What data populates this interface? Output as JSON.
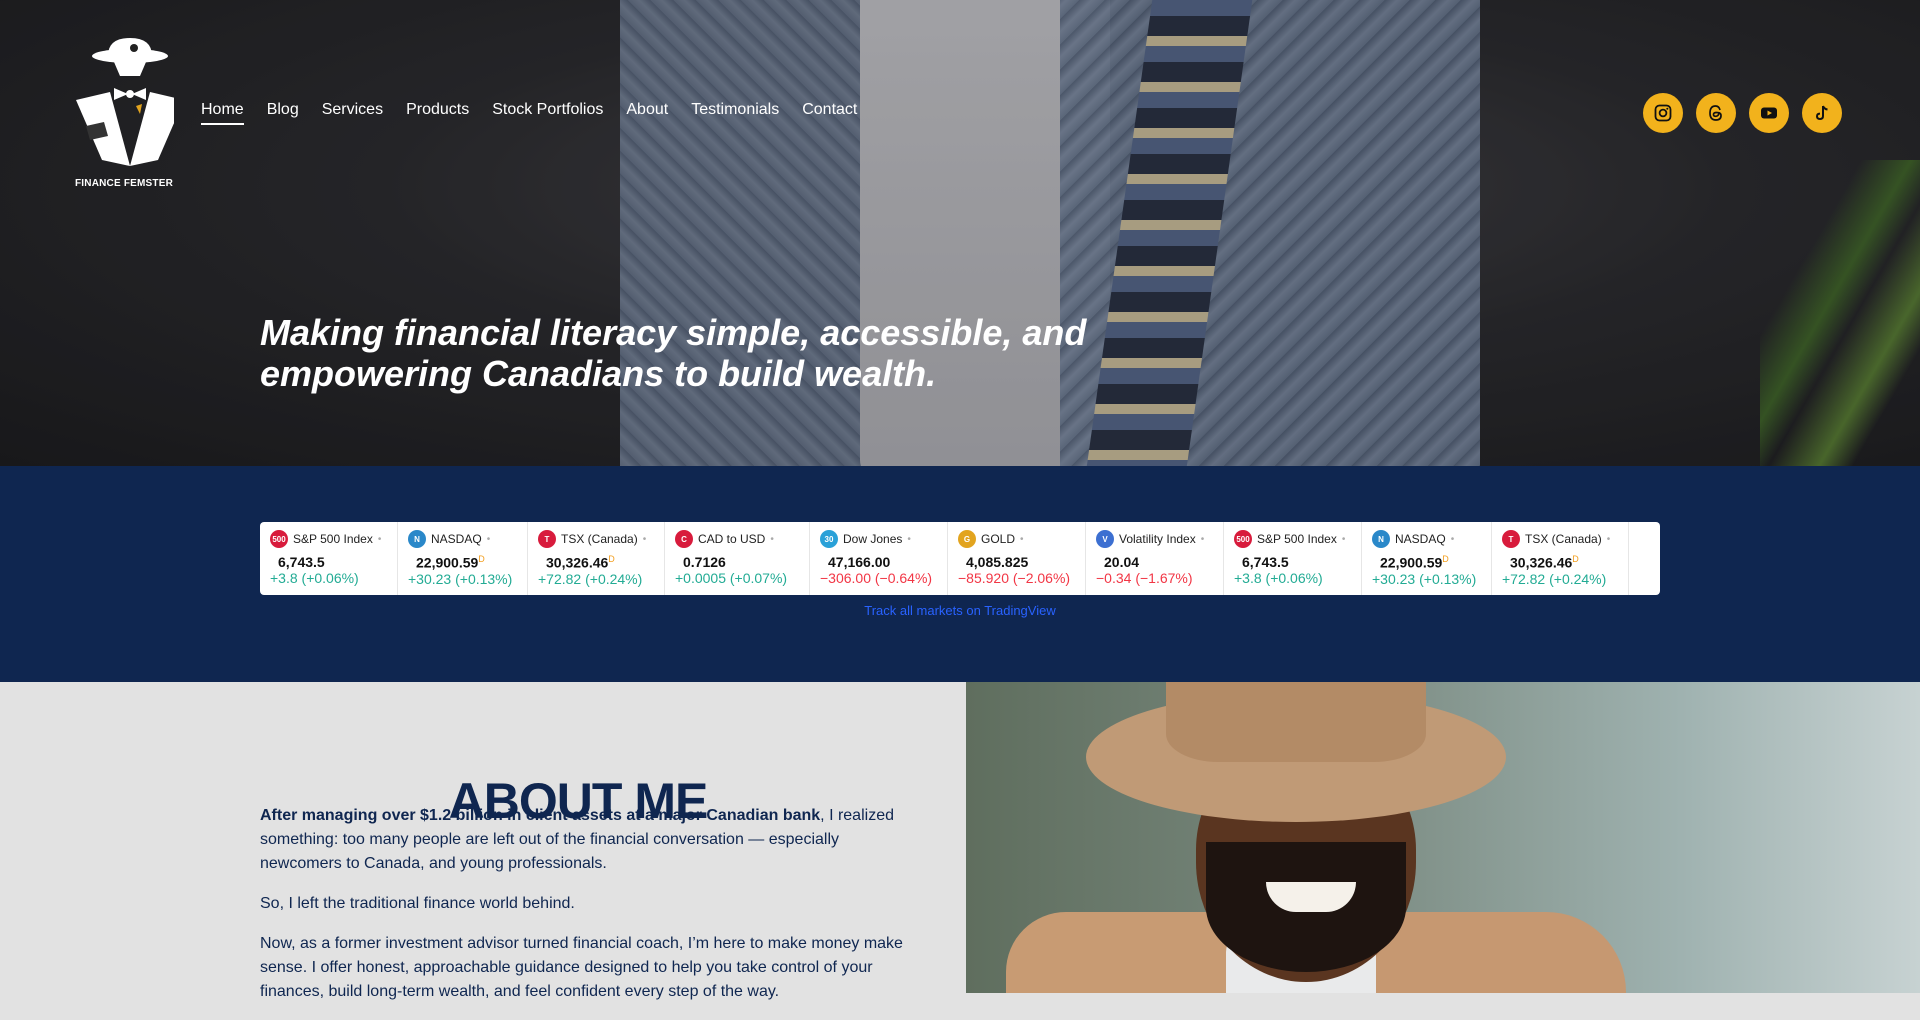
{
  "brand": {
    "name": "FINANCE FEMSTER"
  },
  "nav": {
    "items": [
      "Home",
      "Blog",
      "Services",
      "Products",
      "Stock Portfolios",
      "About",
      "Testimonials",
      "Contact"
    ],
    "active": "Home"
  },
  "socials": [
    "instagram-icon",
    "threads-icon",
    "youtube-icon",
    "tiktok-icon"
  ],
  "hero": {
    "title": "Making financial literacy simple, accessible, and empowering Canadians to build wealth."
  },
  "ticker": {
    "items": [
      {
        "name": "S&P 500 Index",
        "icon_text": "500",
        "icon_color": "#d81b3c",
        "price": "6,743.5",
        "delayed": false,
        "change": "+3.8 (+0.06%)",
        "direction": "up"
      },
      {
        "name": "NASDAQ",
        "icon_text": "N",
        "icon_color": "#2a88c9",
        "price": "22,900.59",
        "delayed": true,
        "change": "+30.23 (+0.13%)",
        "direction": "up"
      },
      {
        "name": "TSX (Canada)",
        "icon_text": "T",
        "icon_color": "#d81b3c",
        "price": "30,326.46",
        "delayed": true,
        "change": "+72.82 (+0.24%)",
        "direction": "up"
      },
      {
        "name": "CAD to USD",
        "icon_text": "C",
        "icon_color": "#d81b3c",
        "price": "0.7126",
        "delayed": false,
        "change": "+0.0005 (+0.07%)",
        "direction": "up"
      },
      {
        "name": "Dow Jones",
        "icon_text": "30",
        "icon_color": "#2aa1d8",
        "price": "47,166.00",
        "delayed": false,
        "change": "−306.00 (−0.64%)",
        "direction": "down"
      },
      {
        "name": "GOLD",
        "icon_text": "G",
        "icon_color": "#e2a41f",
        "price": "4,085.825",
        "delayed": false,
        "change": "−85.920 (−2.06%)",
        "direction": "down"
      },
      {
        "name": "Volatility Index",
        "icon_text": "V",
        "icon_color": "#3c6fd1",
        "price": "20.04",
        "delayed": false,
        "change": "−0.34 (−1.67%)",
        "direction": "down"
      },
      {
        "name": "S&P 500 Index",
        "icon_text": "500",
        "icon_color": "#d81b3c",
        "price": "6,743.5",
        "delayed": false,
        "change": "+3.8 (+0.06%)",
        "direction": "up"
      },
      {
        "name": "NASDAQ",
        "icon_text": "N",
        "icon_color": "#2a88c9",
        "price": "22,900.59",
        "delayed": true,
        "change": "+30.23 (+0.13%)",
        "direction": "up"
      },
      {
        "name": "TSX (Canada)",
        "icon_text": "T",
        "icon_color": "#d81b3c",
        "price": "30,326.46",
        "delayed": true,
        "change": "+72.82 (+0.24%)",
        "direction": "up"
      }
    ],
    "delayed_marker": "D",
    "link_text": "Track all markets on TradingView"
  },
  "about": {
    "title": "ABOUT ME",
    "p1_bold": "After managing over $1.2 billion in client assets at a major Canadian bank",
    "p1_rest": ", I realized something: too many people are left out of the financial conversation — especially newcomers to Canada, and young professionals.",
    "p2": "So, I left the traditional finance world behind.",
    "p3": "Now, as a former investment advisor turned financial coach, I’m here to make money make sense. I offer honest, approachable guidance designed to help you take control of your finances, build long-term wealth, and feel confident every step of the way."
  },
  "colors": {
    "navy": "#0f2650",
    "accent_gold": "#f2b21c",
    "up": "#22ab94",
    "down": "#f23645",
    "link": "#2962ff"
  }
}
